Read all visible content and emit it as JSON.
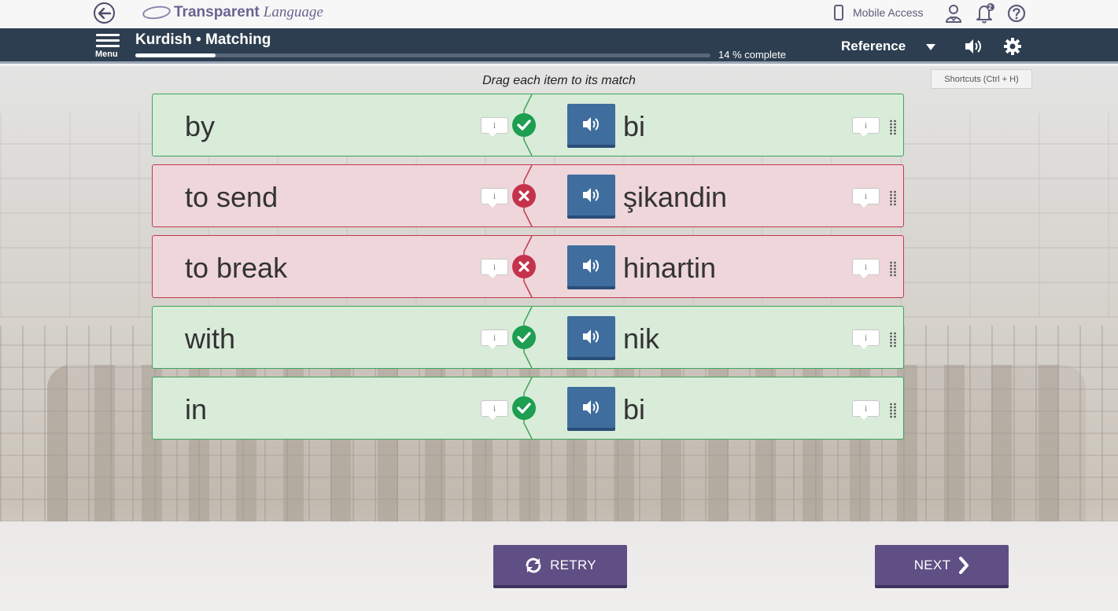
{
  "header": {
    "logo_main": "Transparent",
    "logo_sub": "Language",
    "mobile_access": "Mobile Access",
    "notification_count": "2"
  },
  "nav": {
    "menu_label": "Menu",
    "course_title": "Kurdish • Matching",
    "progress_text": "14 % complete",
    "progress_fraction": 0.14,
    "reference_label": "Reference"
  },
  "activity": {
    "shortcuts_hint": "Shortcuts (Ctrl + H)",
    "instruction": "Drag each item to its match",
    "info_glyph": "i",
    "rows": [
      {
        "english": "by",
        "kurdish": "bi",
        "status": "correct"
      },
      {
        "english": "to send",
        "kurdish": "şikandin",
        "status": "incorrect"
      },
      {
        "english": "to break",
        "kurdish": "hinartin",
        "status": "incorrect"
      },
      {
        "english": "with",
        "kurdish": "nik",
        "status": "correct"
      },
      {
        "english": "in",
        "kurdish": "bi",
        "status": "correct"
      }
    ]
  },
  "footer": {
    "retry_label": "RETRY",
    "next_label": "NEXT"
  },
  "colors": {
    "navbar": "#2d3e50",
    "correct_bg": "#d9ebd9",
    "incorrect_bg": "#eed6da",
    "correct_badge": "#1d9e50",
    "incorrect_badge": "#c5324b",
    "audio_button": "#3f6d9e",
    "action_button": "#5f4f84"
  },
  "icons": {
    "back": "arrow-left-circle-icon",
    "mobile": "mobile-phone-icon",
    "profile": "user-icon",
    "notifications": "bell-icon",
    "help": "question-circle-icon",
    "menu": "hamburger-icon",
    "sound": "speaker-icon",
    "settings": "gear-icon",
    "retry": "refresh-icon",
    "next": "chevron-right-icon"
  }
}
